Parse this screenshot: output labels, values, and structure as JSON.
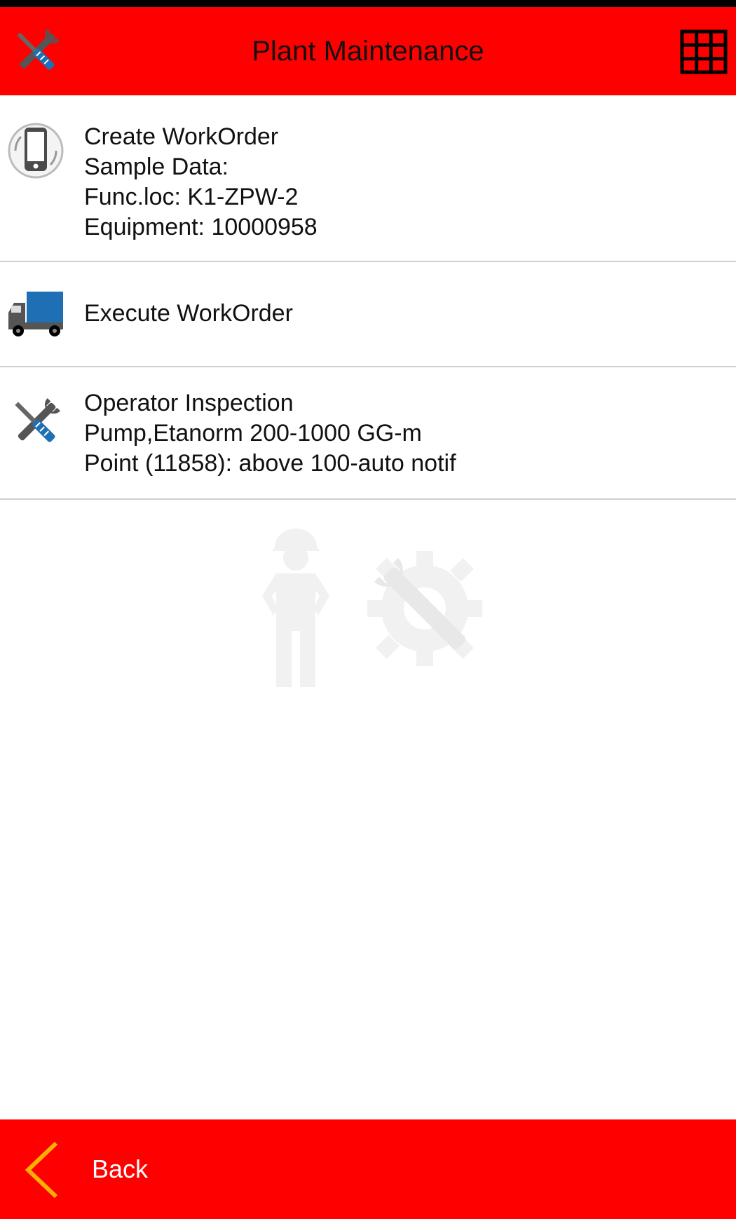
{
  "header": {
    "title": "Plant Maintenance",
    "icon": "tools-icon",
    "menu_icon": "grid-menu-icon"
  },
  "colors": {
    "brand_red": "#ff0000",
    "divider": "#cfcfcf",
    "back_chevron": "#ffb000",
    "icon_blue": "#1e6fb3",
    "icon_gray": "#555555"
  },
  "menu": {
    "items": [
      {
        "icon": "phone-icon",
        "lines": [
          "Create WorkOrder",
          "Sample Data:",
          "Func.loc: K1-ZPW-2",
          "Equipment: 10000958"
        ]
      },
      {
        "icon": "truck-icon",
        "lines": [
          "Execute WorkOrder"
        ]
      },
      {
        "icon": "tools-icon",
        "lines": [
          "Operator Inspection",
          "Pump,Etanorm 200-1000 GG-m",
          "Point (11858): above 100-auto notif"
        ]
      }
    ]
  },
  "watermark_icon": "worker-gear-watermark-icon",
  "footer": {
    "back_label": "Back",
    "back_icon": "chevron-left-icon"
  }
}
